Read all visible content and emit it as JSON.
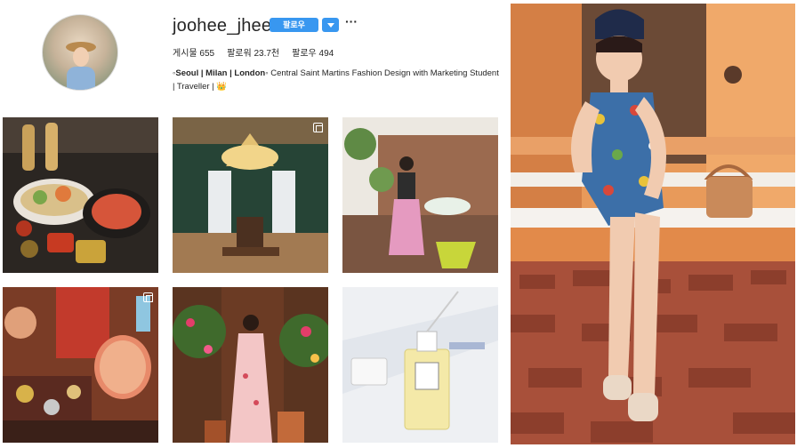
{
  "profile": {
    "username": "joohee_jhee",
    "follow_label": "팔로우",
    "more_label": "···",
    "stats": {
      "posts": "게시물 655",
      "followers": "팔로워 23.7천",
      "following": "팔로우 494"
    },
    "bio_line1_prefix": "◦",
    "bio_bold": "Seoul | Milan | London",
    "bio_line1_suffix": "◦ Central Saint Martins Fashion Design with Marketing Student",
    "bio_line2": "| Traveller | 👑"
  },
  "grid": {
    "posts": [
      {
        "id": "food",
        "multi": false
      },
      {
        "id": "chandelier-hall",
        "multi": true
      },
      {
        "id": "balcony",
        "multi": false
      },
      {
        "id": "jewelry-market",
        "multi": true
      },
      {
        "id": "flower-doorway",
        "multi": false
      },
      {
        "id": "perfume-bottle",
        "multi": false
      }
    ]
  },
  "side_photo": {
    "subject": "woman-sitting-on-steps"
  }
}
